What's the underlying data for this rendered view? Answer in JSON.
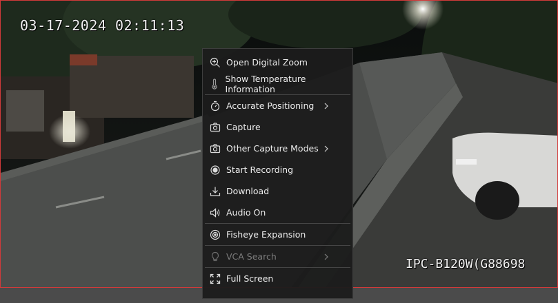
{
  "osd": {
    "timestamp": "03-17-2024 02:11:13",
    "camera_name": "IPC-B120W(G88698"
  },
  "context_menu": {
    "items": [
      {
        "label": "Open Digital Zoom",
        "icon": "zoom-in-icon",
        "submenu": false,
        "enabled": true
      },
      {
        "label": "Show Temperature Information",
        "icon": "thermometer-icon",
        "submenu": false,
        "enabled": true
      },
      {
        "label": "Accurate Positioning",
        "icon": "timer-icon",
        "submenu": true,
        "enabled": true
      },
      {
        "label": "Capture",
        "icon": "camera-icon",
        "submenu": false,
        "enabled": true
      },
      {
        "label": "Other Capture Modes",
        "icon": "camera-icon",
        "submenu": true,
        "enabled": true
      },
      {
        "label": "Start Recording",
        "icon": "record-icon",
        "submenu": false,
        "enabled": true
      },
      {
        "label": "Download",
        "icon": "download-icon",
        "submenu": false,
        "enabled": true
      },
      {
        "label": "Audio On",
        "icon": "speaker-icon",
        "submenu": false,
        "enabled": true
      },
      {
        "label": "Fisheye Expansion",
        "icon": "fisheye-icon",
        "submenu": false,
        "enabled": true
      },
      {
        "label": "VCA Search",
        "icon": "lightbulb-icon",
        "submenu": true,
        "enabled": false
      },
      {
        "label": "Full Screen",
        "icon": "fullscreen-icon",
        "submenu": false,
        "enabled": true
      }
    ]
  },
  "colors": {
    "viewport_border": "#d23a3a",
    "menu_bg": "#1c1c1c",
    "menu_text": "#ececec",
    "menu_text_disabled": "#7d7d7d"
  }
}
